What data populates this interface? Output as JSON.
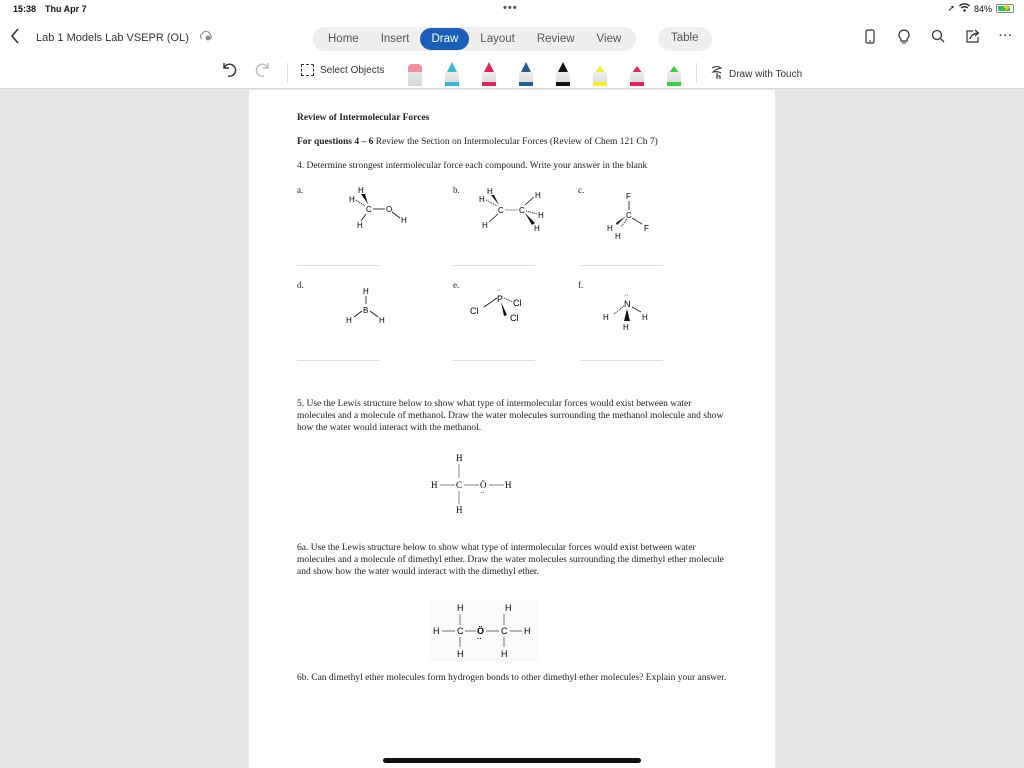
{
  "status": {
    "time": "15:38",
    "date": "Thu Apr 7",
    "battery_pct": "84%",
    "battery_level": 0.84
  },
  "title_bar": {
    "doc_title": "Lab 1 Models Lab VSEPR (OL)",
    "tabs": [
      {
        "label": "Home",
        "active": false
      },
      {
        "label": "Insert",
        "active": false
      },
      {
        "label": "Draw",
        "active": true
      },
      {
        "label": "Layout",
        "active": false
      },
      {
        "label": "Review",
        "active": false
      },
      {
        "label": "View",
        "active": false
      }
    ],
    "table_tab": "Table",
    "icons": [
      "phone-view-icon",
      "lightbulb-icon",
      "search-icon",
      "share-icon",
      "more-icon"
    ]
  },
  "toolbar": {
    "select_objects": "Select Objects",
    "draw_with_touch": "Draw with Touch",
    "pens": [
      {
        "name": "eraser",
        "color": "#f2909c"
      },
      {
        "name": "pen-cyan",
        "color": "#3bb8d8"
      },
      {
        "name": "pen-pink",
        "color": "#e3245a"
      },
      {
        "name": "pen-blue",
        "color": "#1f5f95"
      },
      {
        "name": "pen-black",
        "color": "#111111"
      },
      {
        "name": "highlighter-yellow",
        "color": "#f4ec2c"
      },
      {
        "name": "highlighter-pink",
        "color": "#e4245c"
      },
      {
        "name": "highlighter-green",
        "color": "#39d33c"
      }
    ]
  },
  "document": {
    "heading": "Review of Intermolecular Forces",
    "for_questions_bold": "For questions 4 – 6",
    "for_questions_rest": " Review the Section on Intermolecular Forces (Review of Chem 121 Ch 7)",
    "q4": "4. Determine strongest intermolecular force each compound.  Write your answer in the blank",
    "labels": [
      "a.",
      "b.",
      "c.",
      "d.",
      "e.",
      "f."
    ],
    "molecules": [
      "CH3OH",
      "C2H6",
      "CH2F2",
      "BH3",
      "PCl3",
      "NH3"
    ],
    "q5": "5. Use the Lewis structure below to show what type of intermolecular forces would exist between water molecules and a molecule of methanol.  Draw the water molecules surrounding the methanol molecule and show how the water would interact with the methanol.",
    "q6a": "6a. Use the Lewis structure below to show what type of intermolecular forces would exist between water molecules and a molecule of dimethyl ether.  Draw the water molecules surrounding the dimethyl ether molecule and show how the water would interact with the dimethyl ether.",
    "q6b": "6b. Can dimethyl ether molecules form hydrogen bonds to other dimethyl ether molecules?  Explain your answer.",
    "atoms": {
      "H": "H",
      "C": "C",
      "O": "O",
      "F": "F",
      "B": "B",
      "P": "P",
      "Cl": "Cl",
      "N": "N",
      "O_lewis": "Ö"
    }
  }
}
